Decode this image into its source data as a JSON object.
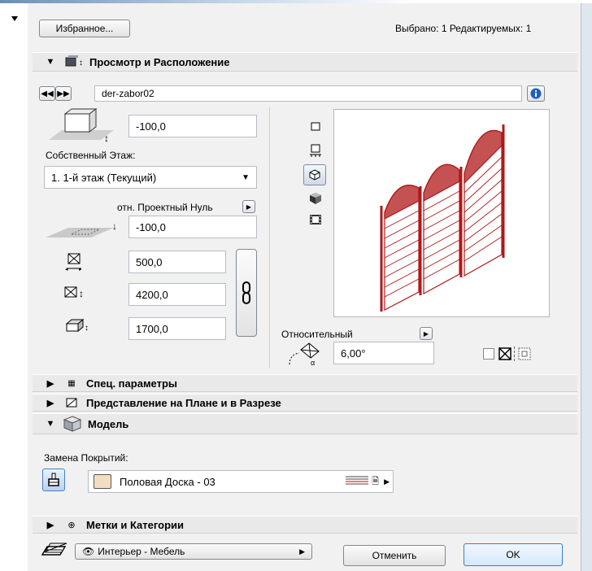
{
  "header": {
    "favorites_label": "Избранное...",
    "selection_status": "Выбрано: 1 Редактируемых: 1"
  },
  "section_view": {
    "title": "Просмотр и Расположение"
  },
  "object": {
    "name": "der-zabor02"
  },
  "position": {
    "height_value": "-100,0",
    "home_story_label": "Собственный Этаж:",
    "home_story_value": "1. 1-й этаж (Текущий)",
    "reference_label": "отн. Проектный Нуль",
    "elevation_value": "-100,0",
    "width_value": "500,0",
    "height2_value": "4200,0",
    "depth_value": "1700,0"
  },
  "preview": {
    "relative_label": "Относительный",
    "angle_value": "6,00°"
  },
  "sections": {
    "custom_params": "Спец. параметры",
    "plan_section": "Представление на Плане и в Разрезе",
    "model": "Модель",
    "tags": "Метки и Категории"
  },
  "model": {
    "override_label": "Замена Покрытий:",
    "material_value": "Половая Доска - 03",
    "material_color": "#f3dcbf"
  },
  "footer": {
    "layer_value": "Интерьер - Мебель",
    "cancel_label": "Отменить",
    "ok_label": "OK"
  },
  "colors": {
    "fence": "#b01818",
    "accent": "#1e68c8"
  }
}
